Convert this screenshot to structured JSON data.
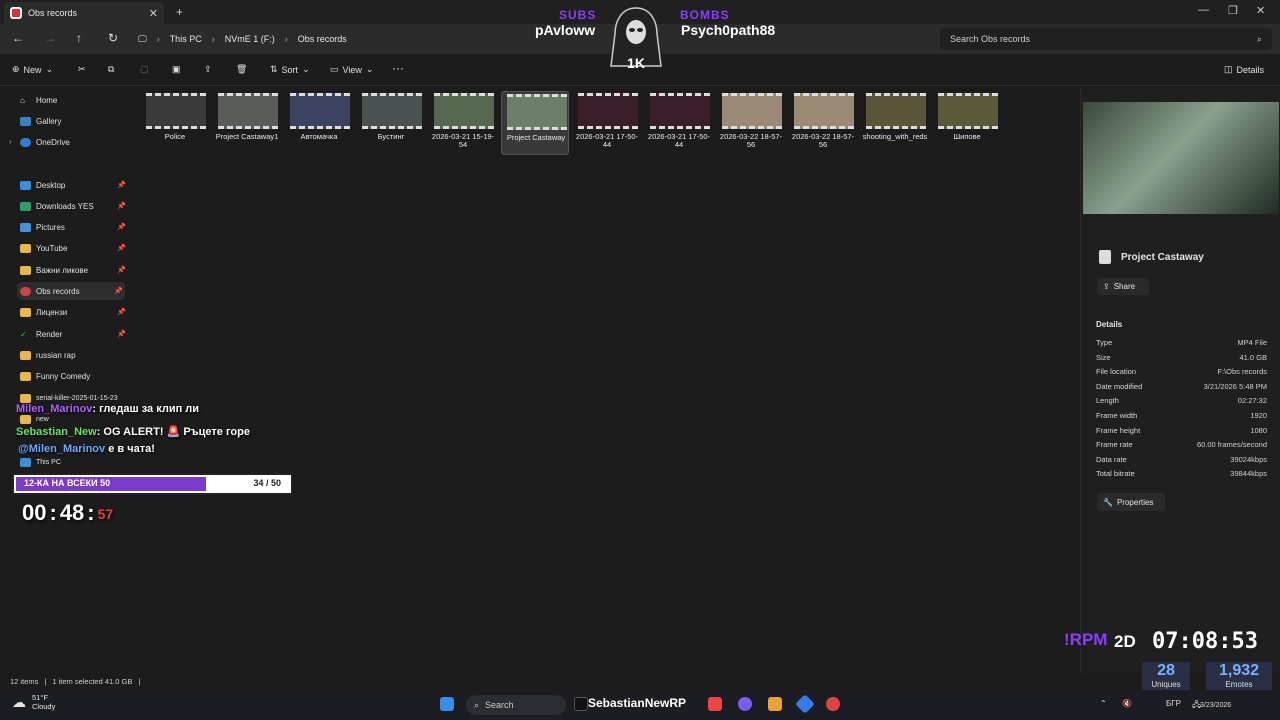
{
  "window": {
    "tab_title": "Obs records"
  },
  "address": {
    "crumbs": [
      "This PC",
      "NVmE 1 (F:)",
      "Obs records"
    ],
    "search_placeholder": "Search Obs records"
  },
  "toolbar": {
    "new": "New",
    "sort": "Sort",
    "view": "View",
    "details": "Details"
  },
  "sidebar": {
    "top": [
      {
        "label": "Home"
      },
      {
        "label": "Gallery"
      },
      {
        "label": "OneDrive"
      }
    ],
    "pinned": [
      {
        "label": "Desktop"
      },
      {
        "label": "Downloads YES"
      },
      {
        "label": "Pictures"
      },
      {
        "label": "YouTube"
      },
      {
        "label": "Важни ликове"
      },
      {
        "label": "Obs records"
      },
      {
        "label": "Лицензи"
      },
      {
        "label": "Render"
      },
      {
        "label": "russian rap"
      },
      {
        "label": "Funny Comedy"
      },
      {
        "label": "serial-killer-2025-01-15-23"
      },
      {
        "label": "new"
      },
      {
        "label": "This PC"
      }
    ]
  },
  "files": [
    {
      "name": "Police",
      "color": "#3b3a3a"
    },
    {
      "name": "Project Castaway1",
      "color": "#5a5e5a"
    },
    {
      "name": "Автомачка",
      "color": "#3c4360"
    },
    {
      "name": "Бустинг",
      "color": "#4b5050"
    },
    {
      "name": "2026-03-21 15-19-54",
      "color": "#56684f"
    },
    {
      "name": "Project Castaway",
      "color": "#6d7f6a"
    },
    {
      "name": "2026-03-21 17-50-44",
      "color": "#3a1f2a"
    },
    {
      "name": "2026-03-21 17-50-44",
      "color": "#3a1f2a"
    },
    {
      "name": "2026-03-22 18-57-56",
      "color": "#9b8a76"
    },
    {
      "name": "2026-03-22 18-57-56",
      "color": "#9b8a76"
    },
    {
      "name": "shooting_with_reds",
      "color": "#5a5538"
    },
    {
      "name": "Шипове",
      "color": "#5a5a3a"
    }
  ],
  "details": {
    "title": "Project Castaway",
    "share": "Share",
    "section": "Details",
    "properties_button": "Properties",
    "props": [
      {
        "k": "Type",
        "v": "MP4 File"
      },
      {
        "k": "Size",
        "v": "41.0 GB"
      },
      {
        "k": "File location",
        "v": "F:\\Obs records"
      },
      {
        "k": "Date modified",
        "v": "3/21/2026 5:48 PM"
      },
      {
        "k": "Length",
        "v": "02:27:32"
      },
      {
        "k": "Frame width",
        "v": "1920"
      },
      {
        "k": "Frame height",
        "v": "1080"
      },
      {
        "k": "Frame rate",
        "v": "60.00 frames/second"
      },
      {
        "k": "Data rate",
        "v": "39024kbps"
      },
      {
        "k": "Total bitrate",
        "v": "39844kbps"
      }
    ]
  },
  "status": {
    "count": "12 items",
    "selected": "1 item selected  41.0 GB"
  },
  "taskbar": {
    "temp": "51°F",
    "cond": "Cloudy",
    "search": "Search",
    "lang": "БГР",
    "date": "3/23/2026"
  },
  "overlay": {
    "subs": "SUBS",
    "bombs": "BOMBS",
    "name1": "pAvloww",
    "name2": "Psych0path88",
    "mascot_badge": "1K",
    "chat": [
      {
        "user": "Milen_Marinov",
        "msg": ": гледаш за клип ли"
      },
      {
        "user": "Sebastian_New",
        "msg": ": OG ALERT! 🚨 Ръцете горе"
      },
      {
        "user": "@Milen_Marinov",
        "msg": " е в чата!"
      }
    ],
    "goal_label": "12-КА НА ВСЕКИ 50",
    "goal_count": "34 / 50",
    "timer_h": "00",
    "timer_m": "48",
    "timer_s": "57",
    "rpm": "!RPM",
    "rpm2": "2D",
    "clock": "07:08:53",
    "stat1_num": "28",
    "stat1_lbl": "Uniques",
    "stat2_num": "1,932",
    "stat2_lbl": "Emotes",
    "ticker": "SebastianNewRP"
  },
  "colors": {
    "accent": "#8a3cff",
    "folder": "#e8b64a"
  }
}
